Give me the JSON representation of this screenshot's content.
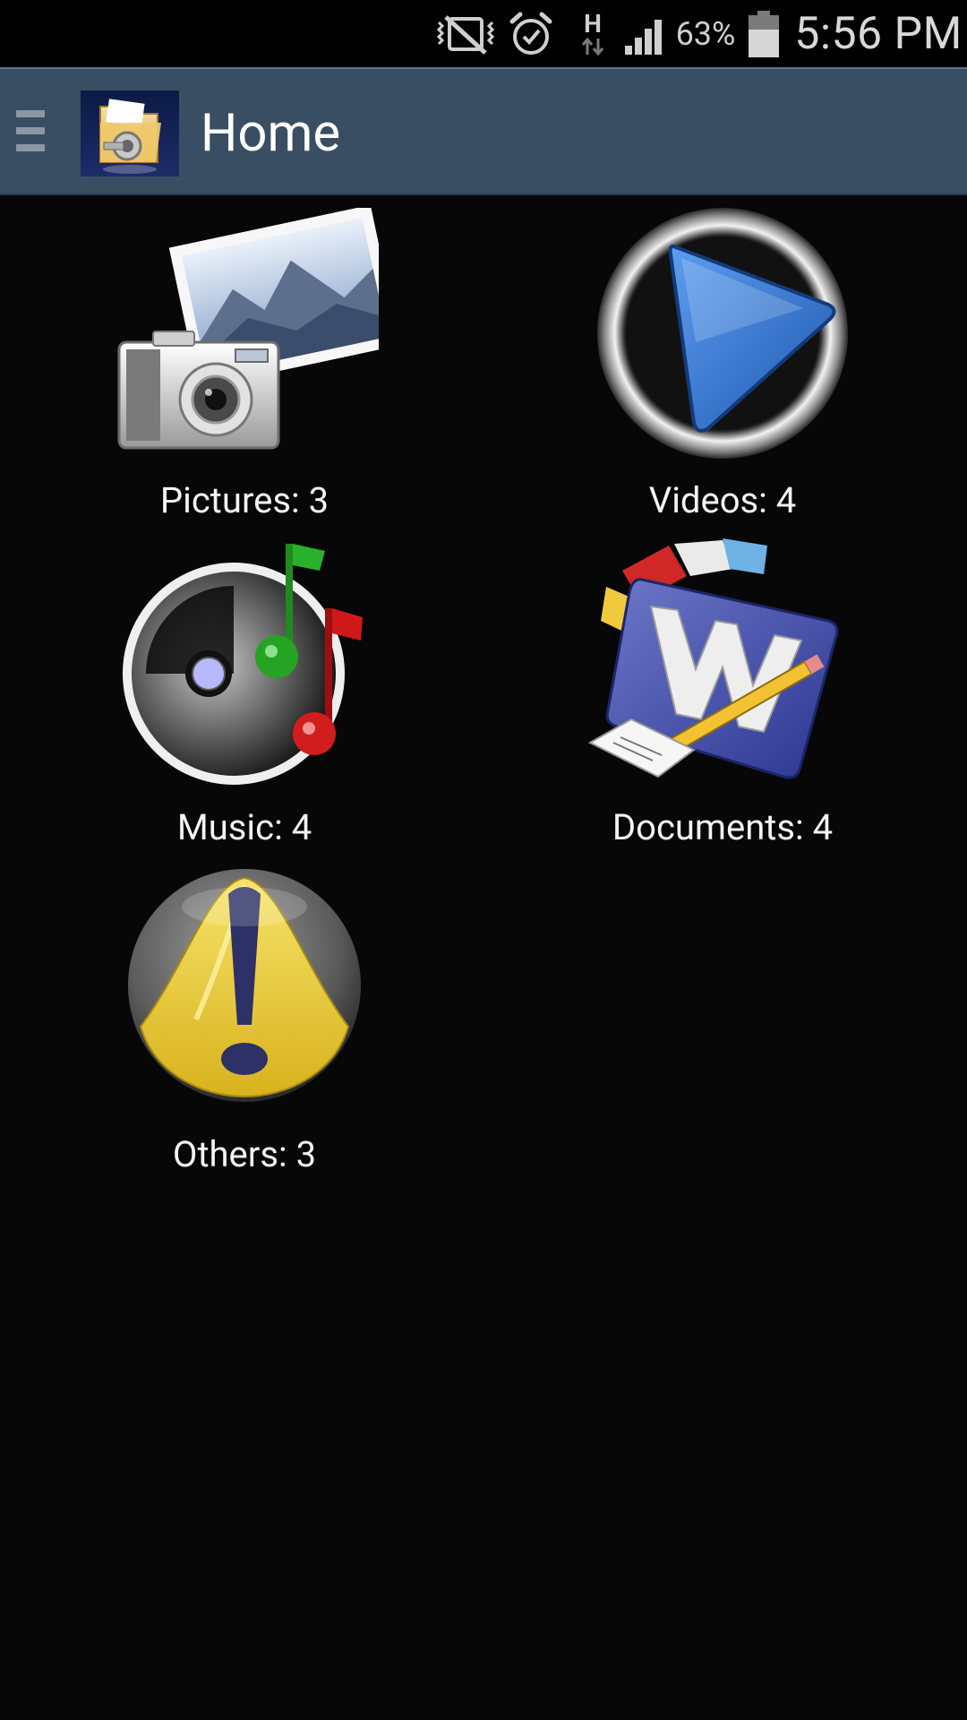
{
  "status_bar": {
    "icons": [
      "vibrate-icon",
      "alarm-icon",
      "hsdpa-icon",
      "signal-icon",
      "battery-icon"
    ],
    "network_type": "H",
    "battery_percent": "63%",
    "time": "5:56 PM"
  },
  "action_bar": {
    "title": "Home",
    "logo_icon": "secure-folder-icon",
    "drawer_icon": "drawer-menu-icon",
    "color": "#3a4e63"
  },
  "categories": [
    {
      "label": "Pictures: 3",
      "icon": "pictures-icon"
    },
    {
      "label": "Videos: 4",
      "icon": "videos-icon"
    },
    {
      "label": "Music: 4",
      "icon": "music-icon"
    },
    {
      "label": "Documents: 4",
      "icon": "documents-icon"
    },
    {
      "label": "Others: 3",
      "icon": "others-icon"
    }
  ]
}
